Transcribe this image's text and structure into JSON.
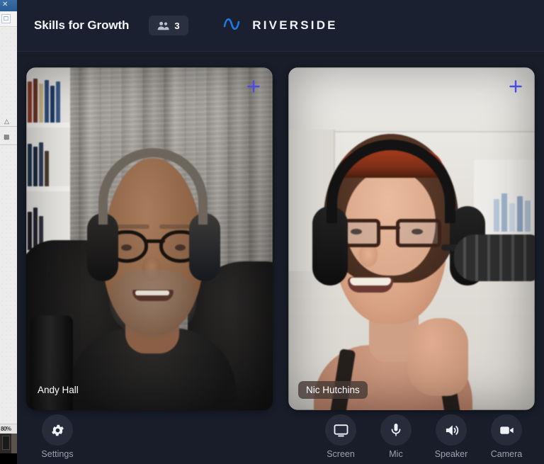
{
  "background_window": {
    "close_label": "✕",
    "ribbon_button_icon": "clipboard-icon",
    "zoom_level": "80%",
    "glyph_collapse": "chevron-up-icon",
    "glyph_move": "move-icon"
  },
  "header": {
    "room_title": "Skills for Growth",
    "participants": {
      "icon": "people-icon",
      "count": "3"
    },
    "brand": {
      "logo_icon": "riverside-wave-icon",
      "name": "RIVERSIDE",
      "accent_color": "#1f7ae0"
    }
  },
  "stage": {
    "tiles": [
      {
        "name": "Andy Hall",
        "add_icon": "plus-icon",
        "name_tag_style": "plain"
      },
      {
        "name": "Nic Hutchins",
        "add_icon": "plus-icon",
        "name_tag_style": "chip"
      }
    ],
    "add_accent_color": "#4a4ae8"
  },
  "footer": {
    "settings": {
      "label": "Settings",
      "icon": "gear-icon"
    },
    "controls": [
      {
        "label": "Screen",
        "icon": "monitor-icon"
      },
      {
        "label": "Mic",
        "icon": "microphone-icon"
      },
      {
        "label": "Speaker",
        "icon": "speaker-icon"
      },
      {
        "label": "Camera",
        "icon": "video-camera-icon"
      }
    ]
  },
  "theme": {
    "app_background": "#181d29",
    "header_background": "#1b2030",
    "control_circle": "#272c3a",
    "label_text": "#9aa1b0"
  }
}
